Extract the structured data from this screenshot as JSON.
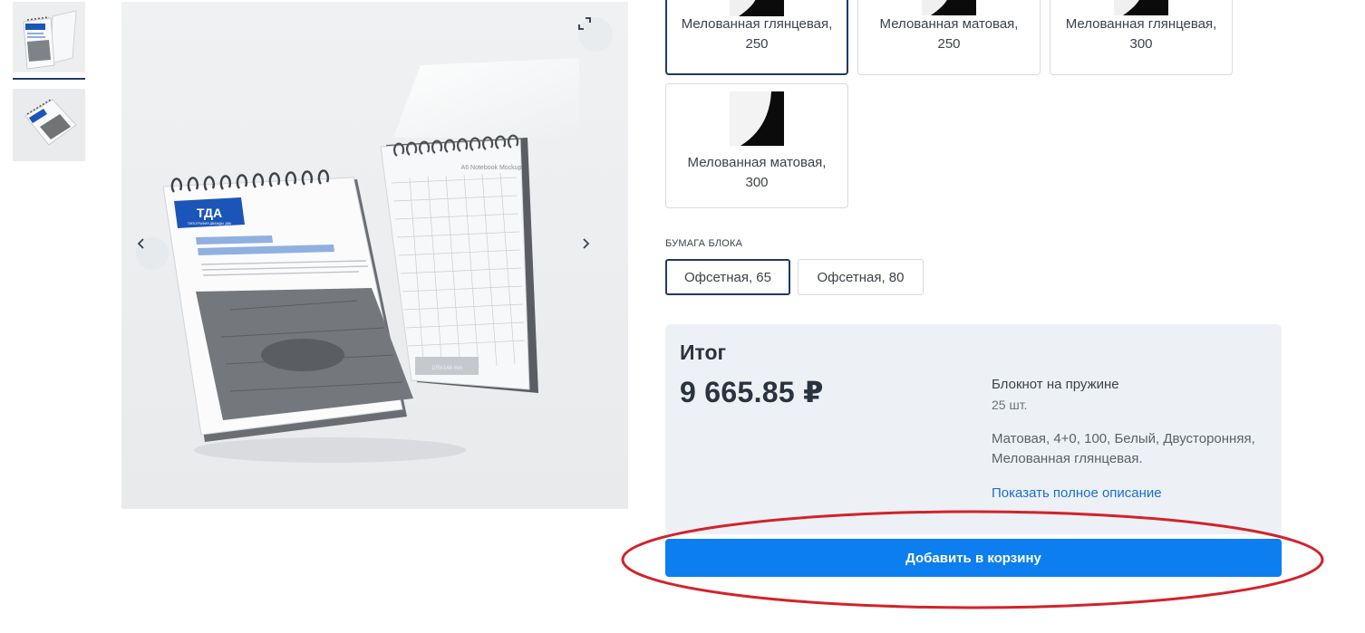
{
  "thumbnails": [
    {
      "name": "thumbnail-1",
      "active": true
    },
    {
      "name": "thumbnail-2",
      "active": false
    }
  ],
  "gallery": {
    "expand_icon": "expand-icon",
    "prev_icon": "chevron-left-icon",
    "next_icon": "chevron-right-icon",
    "mockup": {
      "logo_text": "ТДА",
      "logo_subtitle": "ТИПОГРАФИЯ ДВАЖДЫ ДВА",
      "notebook_label": "A6 Notebook Mockup",
      "size_label": "105x144 mm"
    }
  },
  "cover_paper": {
    "options": [
      {
        "label": "Мелованная глянцевая, 250",
        "selected": true
      },
      {
        "label": "Мелованная матовая, 250",
        "selected": false
      },
      {
        "label": "Мелованная глянцевая, 300",
        "selected": false
      },
      {
        "label": "Мелованная матовая, 300",
        "selected": false
      }
    ]
  },
  "block_paper": {
    "title": "БУМАГА БЛОКА",
    "options": [
      {
        "label": "Офсетная, 65",
        "selected": true
      },
      {
        "label": "Офсетная, 80",
        "selected": false
      }
    ]
  },
  "total": {
    "title": "Итог",
    "price": "9 665.85 ₽",
    "product": "Блокнот на пружине",
    "quantity": "25 шт.",
    "options": "Матовая, 4+0, 100, Белый, Двусторонняя, Мелованная глянцевая.",
    "show_more": "Показать полное описание"
  },
  "cart_button": "Добавить в корзину",
  "colors": {
    "accent": "#0d7ef0",
    "selected_border": "#1e3a68",
    "link": "#1b70c9",
    "highlight": "#d4222a"
  }
}
